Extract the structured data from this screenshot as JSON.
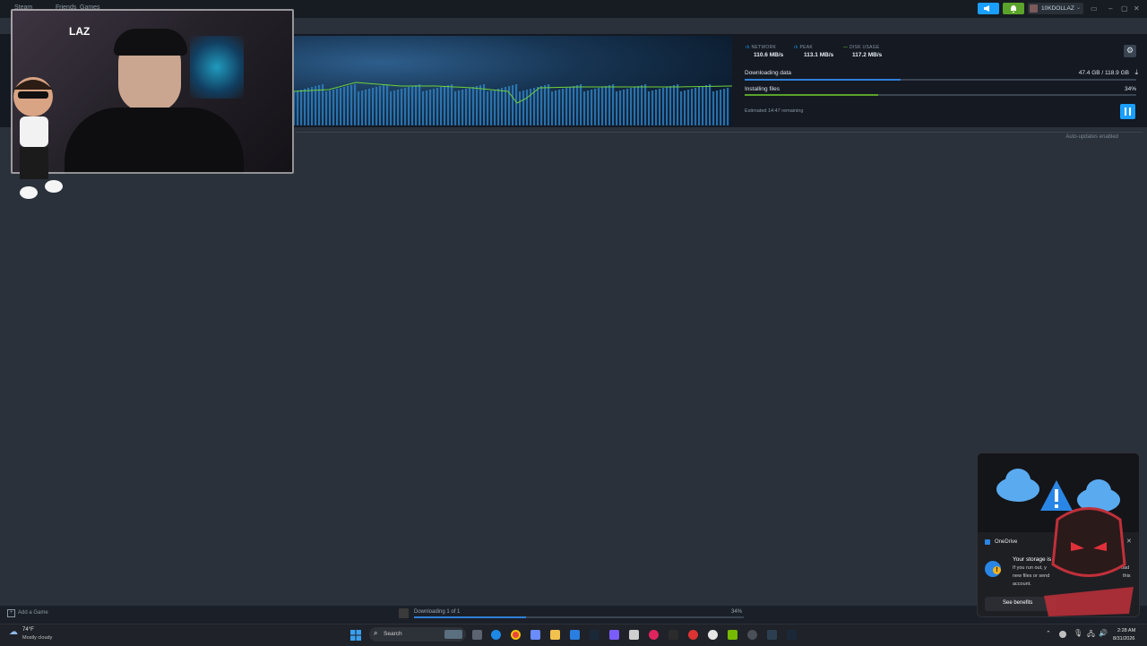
{
  "topbar": {
    "menu": [
      "Steam",
      "Friends",
      "Games"
    ],
    "username": "10KDOLLAZ",
    "window_controls": [
      "▭",
      "–",
      "▢",
      "✕"
    ]
  },
  "webcam": {
    "label": "LAZ"
  },
  "download": {
    "stats": {
      "network_label": "NETWORK",
      "network_value": "110.6 MB/s",
      "peak_label": "PEAK",
      "peak_value": "113.1 MB/s",
      "disk_label": "DISK USAGE",
      "disk_value": "117.2 MB/s"
    },
    "downloading_label": "Downloading data",
    "downloading_value": "47.4 GB / 118.9 GB",
    "downloading_progress": 0.399,
    "installing_label": "Installing files",
    "installing_percent": "34%",
    "installing_progress": 0.34,
    "estimated": "Estimated 14:47 remaining",
    "auto_updates": "Auto-updates enabled"
  },
  "bottom": {
    "add_game": "Add a Game",
    "status": "Downloading 1 of 1",
    "percent": "34%",
    "progress": 0.34
  },
  "taskbar": {
    "weather_temp": "74°F",
    "weather_desc": "Mostly cloudy",
    "search_placeholder": "Search",
    "time": "2:28 AM",
    "date": "8/31/2026"
  },
  "toast": {
    "app": "OneDrive",
    "title": "Your storage is",
    "body_1": "If you run out, y",
    "body_2": "new files or send",
    "body_3": "account.",
    "body_right_1": "oad",
    "body_right_2": "this",
    "button": "See benefits"
  },
  "colors": {
    "accent_blue": "#1a9fff",
    "progress_blue": "#2f80d8",
    "install_green": "#5ba32b",
    "disk_line_green": "#6fd13a"
  }
}
